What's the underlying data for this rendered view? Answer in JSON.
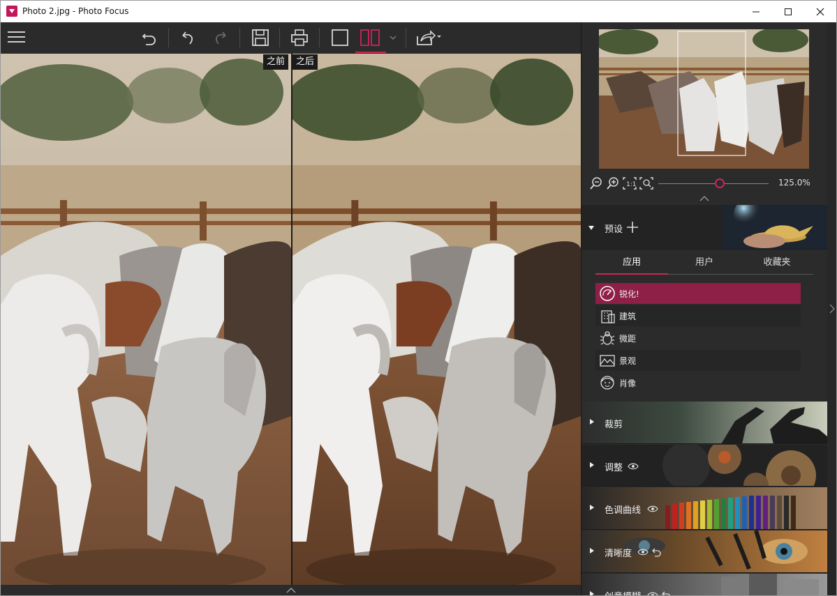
{
  "window": {
    "title": "Photo 2.jpg - Photo Focus"
  },
  "compare": {
    "before_label": "之前",
    "after_label": "之后"
  },
  "zoom": {
    "level": "125.0%",
    "slider_fraction": 0.56
  },
  "presets": {
    "title": "预设",
    "tabs": [
      {
        "label": "应用",
        "active": true
      },
      {
        "label": "用户",
        "active": false
      },
      {
        "label": "收藏夹",
        "active": false
      }
    ],
    "items": [
      {
        "label": "锐化!",
        "icon": "gauge-icon",
        "selected": true
      },
      {
        "label": "建筑",
        "icon": "building-icon",
        "selected": false
      },
      {
        "label": "微距",
        "icon": "bug-icon",
        "selected": false
      },
      {
        "label": "景观",
        "icon": "landscape-icon",
        "selected": false
      },
      {
        "label": "肖像",
        "icon": "portrait-icon",
        "selected": false
      }
    ]
  },
  "sections": [
    {
      "label": "裁剪",
      "eye": false,
      "reset": false
    },
    {
      "label": "调整",
      "eye": true,
      "reset": false
    },
    {
      "label": "色调曲线",
      "eye": true,
      "reset": false
    },
    {
      "label": "清晰度",
      "eye": true,
      "reset": true
    },
    {
      "label": "创意模糊",
      "eye": true,
      "reset": true
    }
  ],
  "colors": {
    "accent": "#d0245a",
    "selected_row": "#8e1f47",
    "panel": "#2b2b2b"
  }
}
